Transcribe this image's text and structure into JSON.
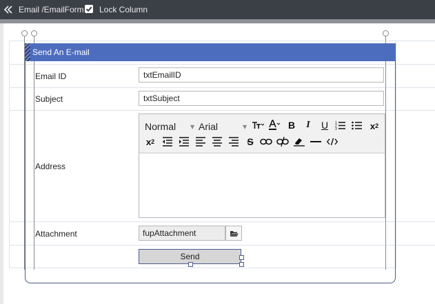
{
  "topbar": {
    "breadcrumb": "Email /EmailForm",
    "lock_label": "Lock Column",
    "lock_checked": true
  },
  "form": {
    "title": "Send An E-mail",
    "rows": [
      {
        "label": "Email ID",
        "value": "txtEmailID"
      },
      {
        "label": "Subject",
        "value": "txtSubject"
      },
      {
        "label": "Address"
      },
      {
        "label": "Attachment",
        "value": "fupAttachment"
      }
    ],
    "send_label": "Send"
  },
  "editor": {
    "format": "Normal",
    "font": "Arial",
    "buttons_row1": [
      "text-size-icon",
      "font-color-icon",
      "bold-icon",
      "italic-icon",
      "underline-icon",
      "ordered-list-icon",
      "unordered-list-icon",
      "subscript-icon"
    ],
    "buttons_row2": [
      "superscript-icon",
      "outdent-icon",
      "indent-icon",
      "align-left-icon",
      "align-center-icon",
      "align-right-icon",
      "strikethrough-icon",
      "link-icon",
      "unlink-icon",
      "clear-format-icon",
      "horizontal-rule-icon",
      "code-icon"
    ]
  },
  "colors": {
    "header": "#4c6cbd",
    "topbar": "#3b3f46",
    "frame": "#4a5c8a"
  }
}
